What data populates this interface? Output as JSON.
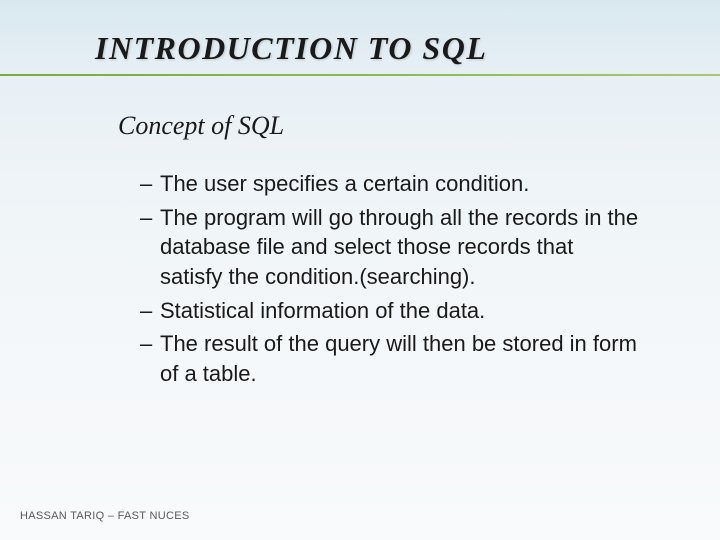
{
  "slide": {
    "title": "INTRODUCTION TO SQL",
    "subtitle": "Concept of SQL",
    "bullets": [
      "The user specifies a certain condition.",
      "The program will go through all the records in the database file and select those records that satisfy the condition.(searching).",
      "Statistical information of the data.",
      "The result of the query will then be stored in form of a table."
    ],
    "footer": "HASSAN TARIQ – FAST NUCES"
  }
}
